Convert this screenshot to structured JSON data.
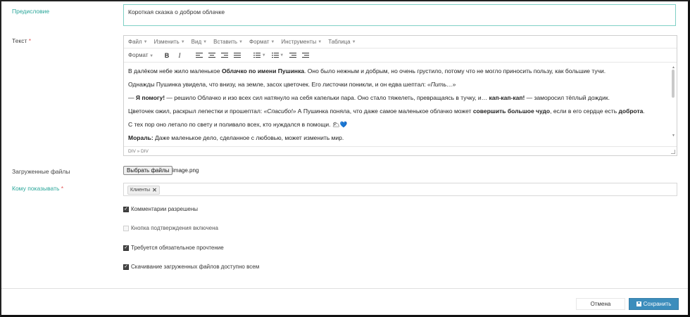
{
  "form": {
    "preface_label": "Предисловие",
    "preface_value": "Короткая сказка о добром облачке",
    "text_label": "Текст",
    "required_mark": "*",
    "files_label": "Загруженные файлы",
    "file_button": "Выбрать файлы",
    "file_name": "image.png",
    "show_to_label": "Кому показывать",
    "show_to_chip": "Клиенты",
    "chip_remove": "✕"
  },
  "editor": {
    "menu": [
      "Файл",
      "Изменить",
      "Вид",
      "Вставить",
      "Формат",
      "Инструменты",
      "Таблица"
    ],
    "toolbar_format": "Формат",
    "bold": "B",
    "italic": "I",
    "status_path": "DIV » DIV",
    "p1_a": "В далёком небе жило маленькое ",
    "p1_b": "Облачко по имени Пушинка",
    "p1_c": ". Оно было нежным и добрым, но очень грустило, потому что не могло приносить пользу, как большие тучи.",
    "p2_a": "Однажды Пушинка увидела, что внизу, на земле, засох цветочек. Его листочки поникли, и он едва шептал: ",
    "p2_b": "«Пить…»",
    "p3_a": "— ",
    "p3_b": "Я помогу!",
    "p3_c": " — решило Облачко и изо всех сил натянуло на себя капельки пара. Оно стало тяжелеть, превращаясь в тучку, и… ",
    "p3_d": "кап-кап-кап!",
    "p3_e": " — заморосил тёплый дождик.",
    "p4_a": "Цветочек ожил, раскрыл лепестки и прошептал: ",
    "p4_b": "«Спасибо!»",
    "p4_c": " А Пушинка поняла, что даже самое маленькое облачко может ",
    "p4_d": "совершить большое чудо",
    "p4_e": ", если в его сердце есть ",
    "p4_f": "доброта",
    "p4_g": ".",
    "p5": "С тех пор оно летало по свету и поливало всех, кто нуждался в помощи. 🌥💙",
    "p6_a": "Мораль:",
    "p6_b": " Даже маленькое дело, сделанное с любовью, может изменить мир."
  },
  "checkboxes": [
    {
      "label": "Комментарии разрешены",
      "checked": true,
      "disabled": false
    },
    {
      "label": "Кнопка подтверждения включена",
      "checked": false,
      "disabled": true
    },
    {
      "label": "Требуется обязательное прочтение",
      "checked": true,
      "disabled": false
    },
    {
      "label": "Скачивание загруженных файлов доступно всем",
      "checked": true,
      "disabled": false
    }
  ],
  "footer": {
    "cancel": "Отмена",
    "save": "Сохранить"
  },
  "colors": {
    "accent": "#3c8dbc",
    "label_green": "#2aa69a",
    "required": "#e25555"
  },
  "icons": [
    "bold-icon",
    "italic-icon",
    "align-left-icon",
    "align-center-icon",
    "align-right-icon",
    "align-justify-icon",
    "bullet-list-icon",
    "numbered-list-icon",
    "outdent-icon",
    "indent-icon",
    "save-icon"
  ]
}
